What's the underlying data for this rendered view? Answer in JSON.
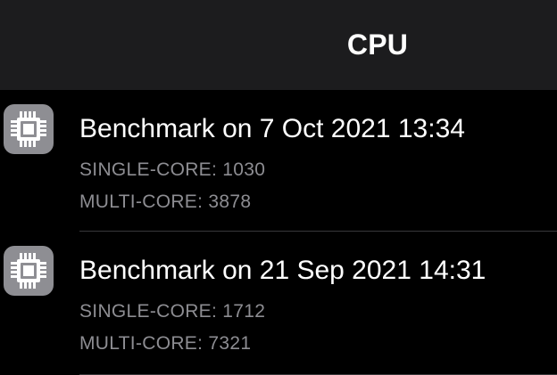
{
  "nav": {
    "title": "CPU"
  },
  "benchmarks": [
    {
      "icon": "cpu-chip-icon",
      "title": "Benchmark on 7 Oct 2021 13:34",
      "single_core": "SINGLE-CORE: 1030",
      "multi_core": "MULTI-CORE: 3878"
    },
    {
      "icon": "cpu-chip-icon",
      "title": "Benchmark on 21 Sep 2021 14:31",
      "single_core": "SINGLE-CORE: 1712",
      "multi_core": "MULTI-CORE: 7321"
    }
  ],
  "colors": {
    "background": "#000000",
    "nav_background": "#1c1c1e",
    "primary_text": "#ffffff",
    "secondary_text": "#8d8d92",
    "icon_background": "#8e8e93",
    "separator": "#38383a"
  }
}
